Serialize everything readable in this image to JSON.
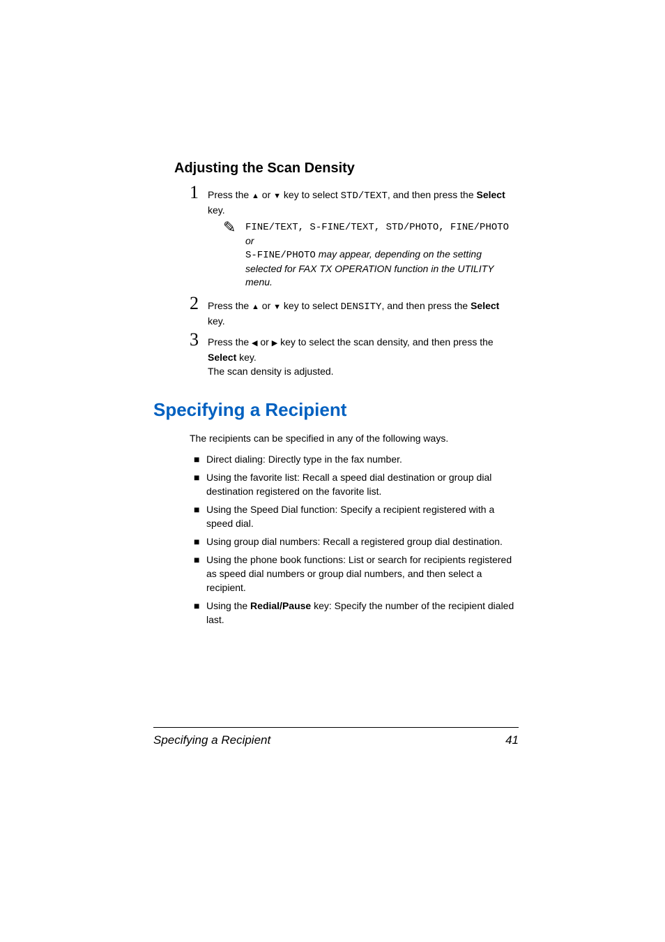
{
  "section1": {
    "heading": "Adjusting the Scan Density",
    "steps": [
      {
        "num": "1",
        "pre": "Press the ",
        "mid": " or ",
        "post1": " key to select ",
        "code": "STD/TEXT",
        "post2": ", and then press the ",
        "boldkey": "Select",
        "tail": " key."
      },
      {
        "num": "2",
        "pre": "Press the ",
        "mid": " or ",
        "post1": " key to select ",
        "code": "DENSITY",
        "post2": ", and then press the ",
        "boldkey": "Select",
        "tail": " key."
      },
      {
        "num": "3",
        "pre": "Press the ",
        "mid": " or ",
        "post1": " key to select the scan density, and then press the ",
        "boldkey": "Select",
        "tail": " key.",
        "extra": "The scan density is adjusted."
      }
    ],
    "note": {
      "line1_codes": "FINE/TEXT, S-FINE/TEXT, STD/PHOTO, FINE/PHOTO",
      "line1_tail": " or ",
      "line2_code": "S-FINE/PHOTO",
      "line2_tail": " may appear, depending on the setting selected for FAX TX OPERATION function in the UTILITY menu."
    }
  },
  "section2": {
    "heading": "Specifying a Recipient",
    "intro": "The recipients can be specified in any of the following ways.",
    "bullets": [
      {
        "text": "Direct dialing: Directly type in the fax number."
      },
      {
        "text": "Using the favorite list: Recall a speed dial destination or group dial destination registered on the favorite list."
      },
      {
        "text": "Using the Speed Dial function: Specify a recipient registered with a speed dial."
      },
      {
        "text": "Using group dial numbers: Recall a registered group dial destination."
      },
      {
        "text": "Using the phone book functions: List or search for recipients registered as speed dial numbers or group dial numbers, and then select a recipient."
      },
      {
        "pre": "Using the ",
        "bold": "Redial/Pause",
        "post": " key: Specify the number of the recipient dialed last."
      }
    ]
  },
  "footer": {
    "left": "Specifying a Recipient",
    "right": "41"
  }
}
